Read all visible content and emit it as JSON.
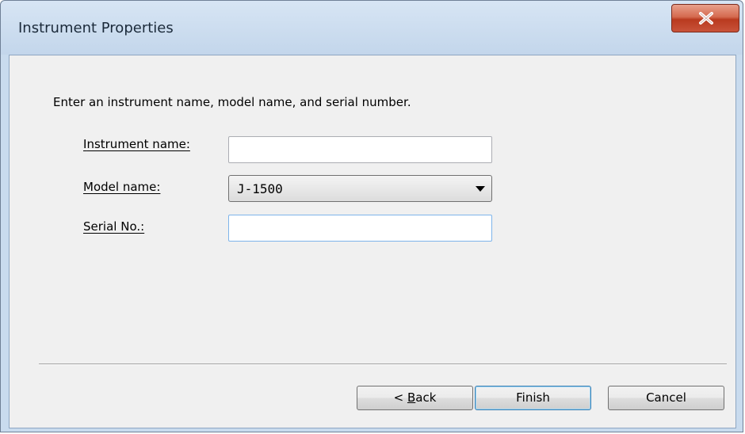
{
  "window": {
    "title": "Instrument Properties"
  },
  "instruction": "Enter an instrument name, model name, and serial number.",
  "fields": {
    "instrument_name": {
      "label_mnemonic": "I",
      "label_rest": "nstrument name:",
      "value": ""
    },
    "model_name": {
      "label_mnemonic": "M",
      "label_rest": "odel name:",
      "value": "J-1500"
    },
    "serial_no": {
      "label_mnemonic": "S",
      "label_rest": "erial No.:",
      "value": ""
    }
  },
  "buttons": {
    "back_prefix": "< ",
    "back_mnemonic": "B",
    "back_rest": "ack",
    "finish": "Finish",
    "cancel": "Cancel"
  },
  "icons": {
    "close": "close-icon",
    "dropdown": "chevron-down-icon"
  },
  "colors": {
    "close_button": "#c9533a",
    "client_background": "#f0f0f0",
    "focus_border": "#7eb4ea"
  }
}
